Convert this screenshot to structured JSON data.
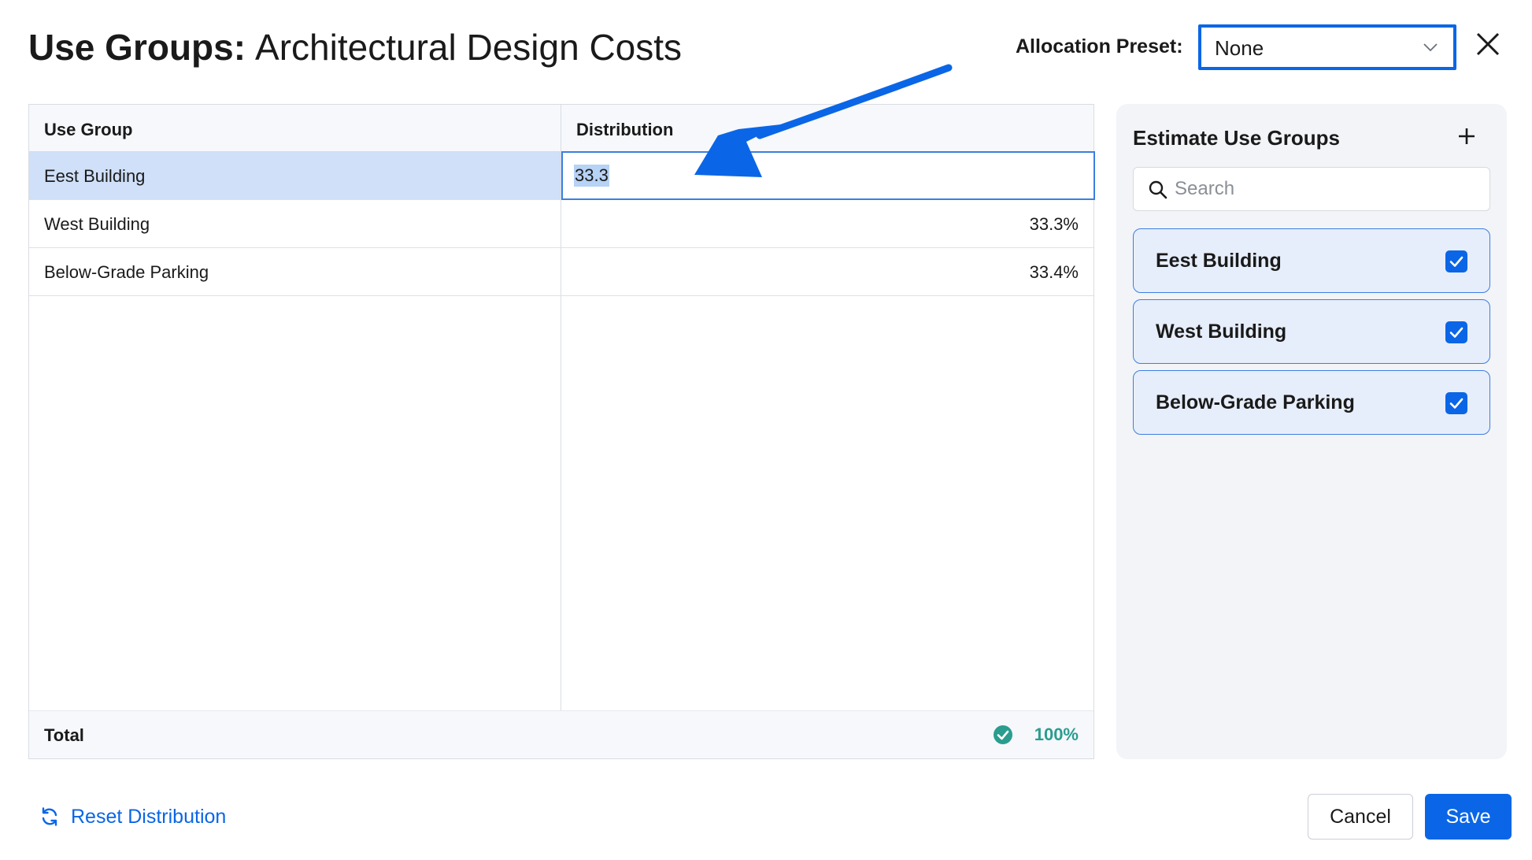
{
  "header": {
    "title_bold": "Use Groups:",
    "title_rest": "Architectural Design Costs",
    "preset_label": "Allocation Preset:",
    "preset_value": "None"
  },
  "table": {
    "columns": [
      "Use Group",
      "Distribution"
    ],
    "rows": [
      {
        "name": "Eest Building",
        "value": "33.3"
      },
      {
        "name": "West Building",
        "value": "33.3%"
      },
      {
        "name": "Below-Grade Parking",
        "value": "33.4%"
      }
    ],
    "total_label": "Total",
    "total_value": "100%"
  },
  "panel": {
    "title": "Estimate Use Groups",
    "search_placeholder": "Search",
    "items": [
      {
        "label": "Eest Building",
        "checked": true
      },
      {
        "label": "West Building",
        "checked": true
      },
      {
        "label": "Below-Grade Parking",
        "checked": true
      }
    ]
  },
  "footer": {
    "reset_label": "Reset Distribution",
    "cancel_label": "Cancel",
    "save_label": "Save"
  },
  "colors": {
    "accent": "#0a66e6",
    "selected_row": "#cfe0f8",
    "success": "#2a9d8f",
    "panel_bg": "#f2f4f7"
  },
  "icons": [
    "close-icon",
    "chevron-down-icon",
    "plus-icon",
    "search-icon",
    "checkbox-checked-icon",
    "check-circle-icon",
    "refresh-icon",
    "annotation-arrow"
  ]
}
